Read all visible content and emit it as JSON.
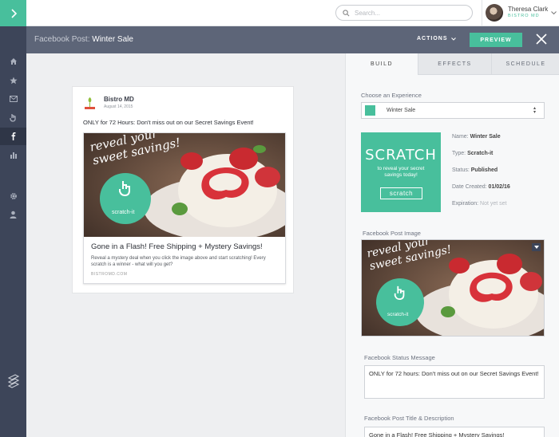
{
  "search": {
    "placeholder": "Search..."
  },
  "user": {
    "name": "Theresa Clark",
    "company": "BISTRO MD"
  },
  "header": {
    "prefix": "Facebook Post:",
    "title": "Winter Sale",
    "actions_label": "ACTIONS",
    "preview_label": "PREVIEW"
  },
  "sidebar": {
    "items": [
      "home-icon",
      "star-icon",
      "mail-icon",
      "hand-icon",
      "facebook-icon",
      "chart-icon",
      "gear-icon",
      "user-icon"
    ],
    "active": "facebook-icon"
  },
  "fb_post": {
    "page_name": "Bistro MD",
    "date": "August 14, 2015",
    "message": "ONLY for 72 Hours: Don't miss out on our Secret Savings Event!",
    "image_text": [
      "reveal your",
      "sweet savings!"
    ],
    "badge_text": "scratch-it",
    "link_title": "Gone in a Flash! Free Shipping + Mystery Savings!",
    "link_desc": "Reveal a mystery deal when you click the image above and start scratching! Every scratch is a winner - what will you get?",
    "link_url": "BISTROMD.COM"
  },
  "tabs": [
    {
      "label": "BUILD",
      "active": true
    },
    {
      "label": "EFFECTS",
      "active": false
    },
    {
      "label": "SCHEDULE",
      "active": false
    }
  ],
  "build": {
    "experience_label": "Choose an Experience",
    "experience_value": "Winter Sale",
    "card": {
      "title": "SCRATCH",
      "subtitle": "to reveal your secret savings today!",
      "button": "scratch"
    },
    "meta": {
      "name_label": "Name:",
      "name": "Winter Sale",
      "type_label": "Type:",
      "type": "Scratch-it",
      "status_label": "Status:",
      "status": "Published",
      "created_label": "Date Created:",
      "created": "01/02/16",
      "expiration_label": "Expiration:",
      "expiration": "Not yet set"
    },
    "post_image_label": "Facebook Post Image",
    "status_message_label": "Facebook Status Message",
    "status_message": "ONLY for 72 hours: Don't miss out on our Secret Savings Event!",
    "title_desc_label": "Facebook Post Title & Description",
    "title_desc": "Gone in a Flash! Free Shipping + Mystery Savings!"
  },
  "colors": {
    "accent": "#48bf9c",
    "sidebar": "#3d4559",
    "header": "#5d6578"
  }
}
